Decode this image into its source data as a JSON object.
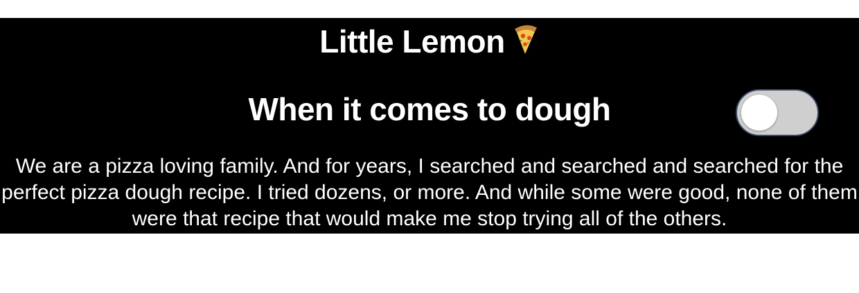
{
  "header": {
    "title": "Little Lemon",
    "icon": "pizza-icon"
  },
  "section": {
    "heading": "When it comes to dough",
    "toggle": {
      "state": "off",
      "track_color": "#cfcfcf",
      "knob_color": "#ffffff"
    },
    "body": "We are a pizza loving family. And for years, I searched and searched and searched for the perfect pizza dough recipe. I tried dozens, or more. And while some were good, none of them were that recipe that would make me stop trying all of the others."
  },
  "colors": {
    "panel_background": "#000000",
    "text": "#ffffff"
  }
}
